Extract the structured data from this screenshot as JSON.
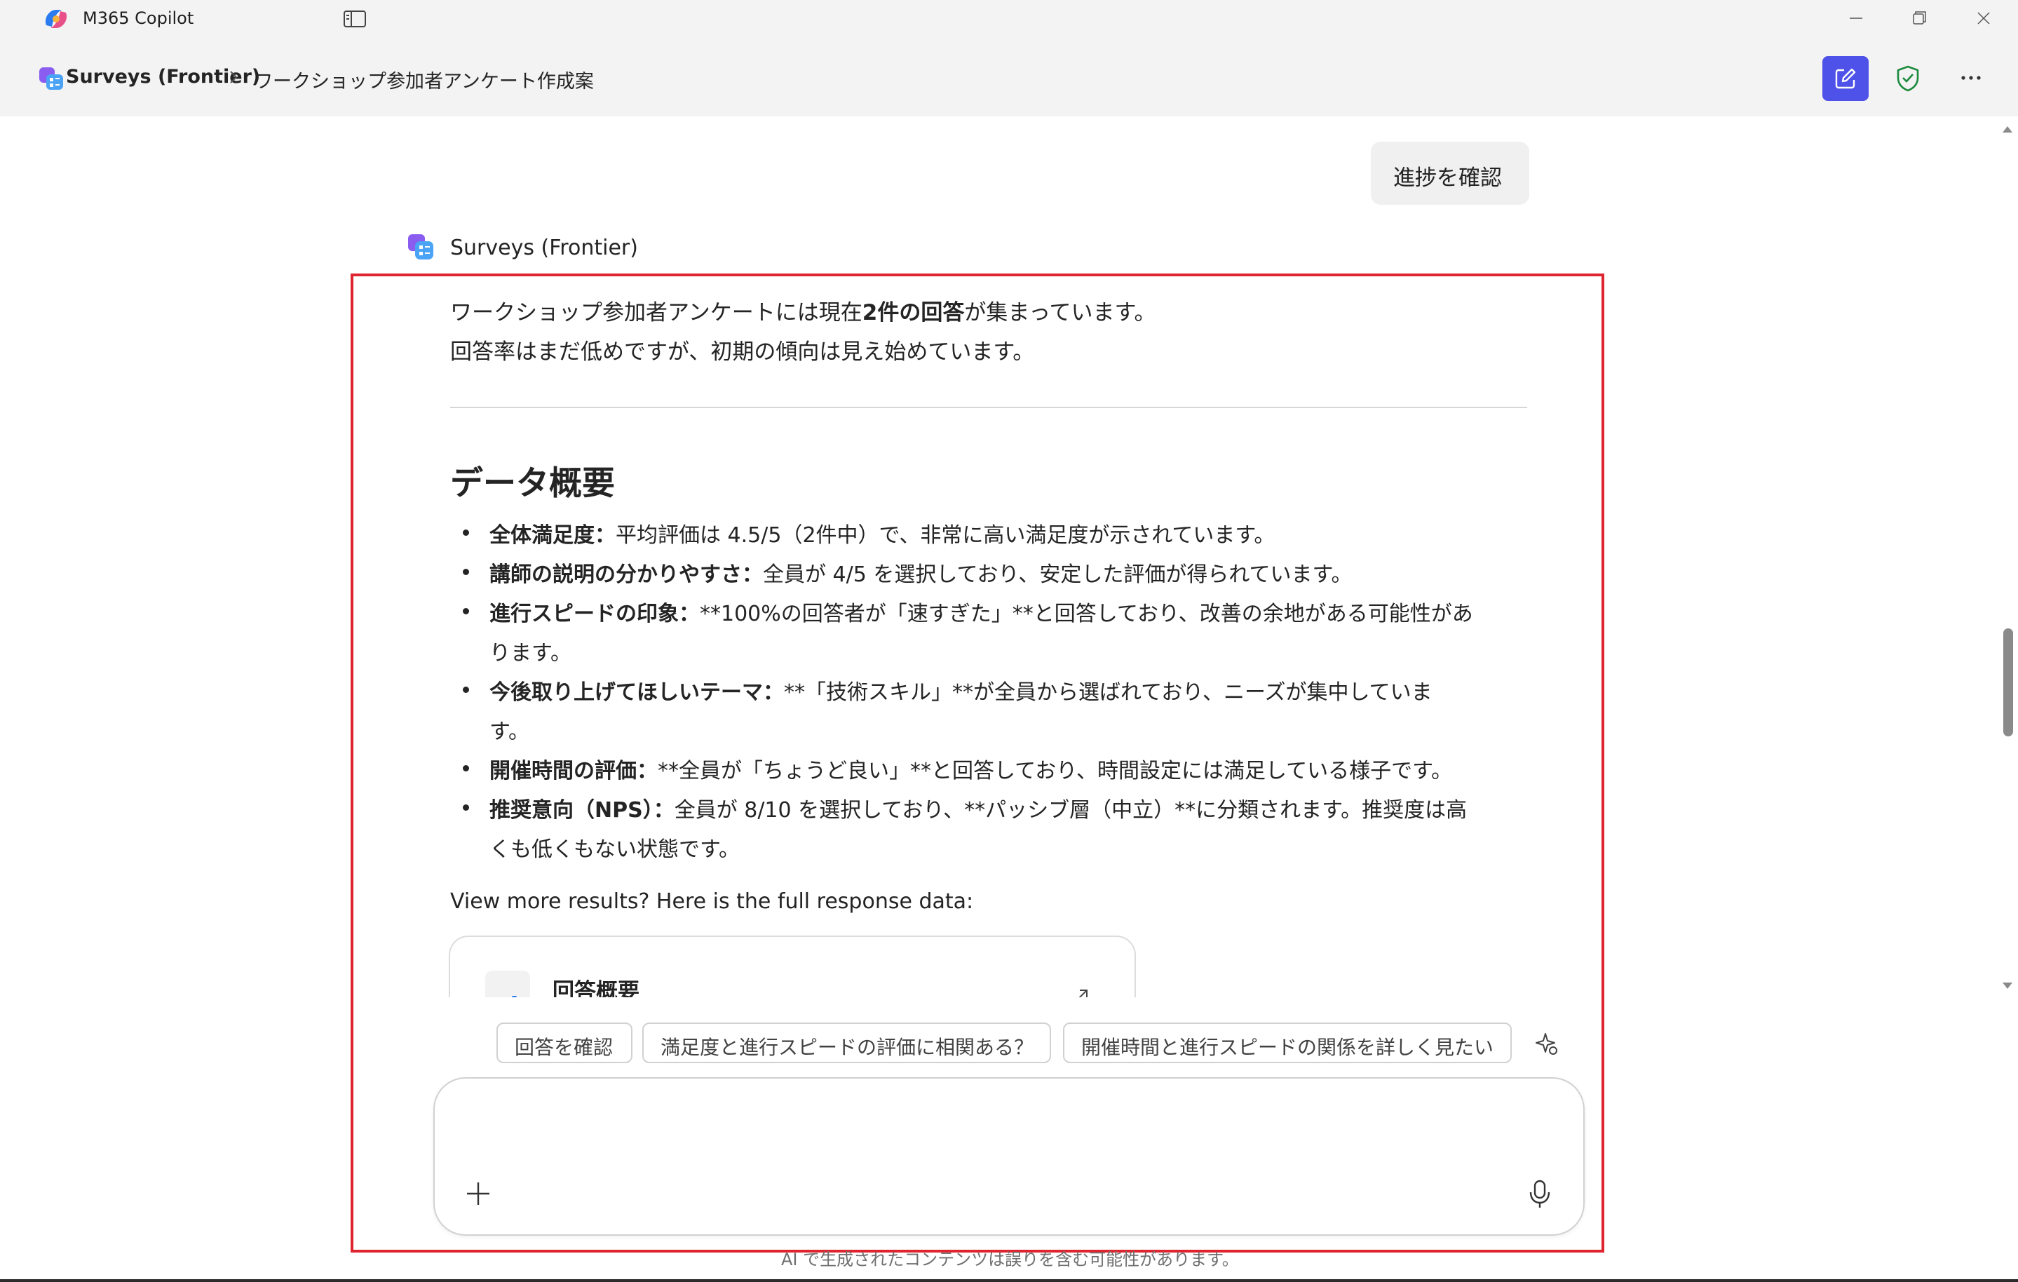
{
  "window": {
    "app_title": "M365 Copilot"
  },
  "header": {
    "agent_name": "Surveys (Frontier)",
    "chat_title": "ワークショップ参加者アンケート作成案"
  },
  "user_message": {
    "text": "進捗を確認"
  },
  "bot": {
    "name": "Surveys (Frontier)",
    "intro_1_pre": "ワークショップ参加者アンケートには現在",
    "intro_1_bold": "2件の回答",
    "intro_1_post": "が集まっています。",
    "intro_2": "回答率はまだ低めですが、初期の傾向は見え始めています。",
    "heading": "データ概要",
    "items": [
      {
        "label": "全体満足度：",
        "lines": [
          "平均評価は 4.5/5（2件中）で、非常に高い満足度が示されています。"
        ]
      },
      {
        "label": "講師の説明の分かりやすさ：",
        "lines": [
          "全員が 4/5 を選択しており、安定した評価が得られています。"
        ]
      },
      {
        "label": "進行スピードの印象：",
        "lines": [
          "**100%の回答者が「速すぎた」**と回答しており、改善の余地がある可能性があ",
          "ります。"
        ]
      },
      {
        "label": "今後取り上げてほしいテーマ：",
        "lines": [
          "**「技術スキル」**が全員から選ばれており、ニーズが集中していま",
          "す。"
        ]
      },
      {
        "label": "開催時間の評価：",
        "lines": [
          "**全員が「ちょうど良い」**と回答しており、時間設定には満足している様子です。"
        ]
      },
      {
        "label": "推奨意向（NPS）：",
        "lines": [
          "全員が 8/10 を選択しており、**パッシブ層（中立）**に分類されます。推奨度は高",
          "くも低くもない状態です。"
        ]
      }
    ],
    "more_results": "View more results? Here is the full response data:",
    "card_title": "回答概要"
  },
  "suggestions": [
    "回答を確認",
    "満足度と進行スピードの評価に相関ある？",
    "開催時間と進行スピードの関係を詳しく見たい"
  ],
  "composer": {
    "placeholder": ""
  },
  "disclaimer": "AI で生成されたコンテンツは誤りを含む可能性があります。",
  "colors": {
    "accent": "#4f52e8",
    "highlight": "#e0242f",
    "shield": "#1a8a3c"
  }
}
